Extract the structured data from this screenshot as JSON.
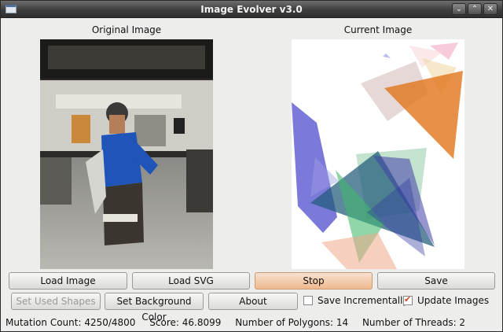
{
  "window": {
    "title": "Image Evolver v3.0",
    "controls": {
      "minimize": "⌄",
      "maximize": "⌃",
      "close": "✕"
    }
  },
  "panels": {
    "original_label": "Original Image",
    "current_label": "Current Image"
  },
  "buttons": {
    "load_image": "Load Image",
    "load_svg": "Load SVG",
    "stop": "Stop",
    "save": "Save",
    "set_used_shapes": "Set Used Shapes",
    "set_background_color": "Set Background Color",
    "about": "About"
  },
  "options": {
    "save_incrementally": {
      "label": "Save Incrementally",
      "checked": false
    },
    "update_images": {
      "label": "Update Images",
      "checked": true
    }
  },
  "status": {
    "mutation_count": "Mutation Count: 4250/4800",
    "score": "Score: 46.8099",
    "polygons": "Number of Polygons: 14",
    "threads": "Number of Threads: 2"
  },
  "colors": {
    "titlebar": "#3e3e3e",
    "window_bg": "#ededec",
    "stop_button": "#f0b88c",
    "check_mark": "#c0492a"
  }
}
